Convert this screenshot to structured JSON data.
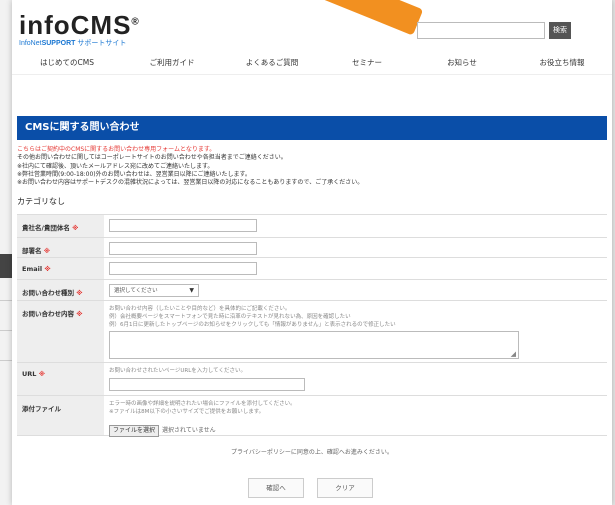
{
  "header": {
    "logo_text": "infoCMS",
    "logo_mark": "®",
    "logo_sub_brand": "InfoNet",
    "logo_sub_bold": "SUPPORT",
    "logo_sub_tail": "サポートサイト",
    "search_button": "検索",
    "search_placeholder": ""
  },
  "nav": [
    {
      "label": "はじめてのCMS"
    },
    {
      "label": "ご利用ガイド"
    },
    {
      "label": "よくあるご質問"
    },
    {
      "label": "セミナー"
    },
    {
      "label": "お知らせ"
    },
    {
      "label": "お役立ち情報"
    }
  ],
  "page_title": "CMSに関する問い合わせ",
  "intro": {
    "line1": "こちらはご契約中のCMSに関するお問い合わせ専用フォームとなります。",
    "line2": "その他お問い合わせに関してはコーポレートサイトのお問い合わせや各担当者までご連絡ください。",
    "line3": "※社内にて確認後、頂いたメールアドレス宛に改めてご連絡いたします。",
    "line4": "※弊社営業時間(9:00-18:00)外のお問い合わせは、翌営業日以降にご連絡いたします。",
    "line5": "※お問い合わせ内容はサポートデスクの混雑状況によっては、翌営業日以降の対応になることもありますので、ご了承ください。"
  },
  "category_label": "カテゴリなし",
  "form": {
    "company": {
      "label": "貴社名/貴団体名",
      "req": "※",
      "value": ""
    },
    "department": {
      "label": "部署名",
      "req": "※",
      "value": ""
    },
    "email": {
      "label": "Email",
      "req": "※",
      "value": ""
    },
    "inquiry_type": {
      "label": "お問い合わせ種別",
      "req": "※",
      "selected": "選択してください"
    },
    "inquiry_content": {
      "label": "お問い合わせ内容",
      "req": "※",
      "hint1": "お問い合わせ内容（したいことや目的など）を具体的にご記載ください。",
      "hint2": "例）会社概要ページをスマートフォンで見た時に沿革のテキストが見れない為、原因を確認したい",
      "hint3": "例）6月1日に更新したトップページのお知らせをクリックしても「情報がありません」と表示されるので修正したい",
      "value": ""
    },
    "url": {
      "label": "URL",
      "req": "※",
      "hint": "お問い合わせされたいページURLを入力してください。",
      "value": ""
    },
    "attachment": {
      "label": "添付ファイル",
      "hint1": "エラー時の画像や詳細を説明されたい場合にファイルを添付してください。",
      "hint2": "※ファイルは8M以下の小さいサイズでご提供をお願いします。",
      "button": "ファイルを選択",
      "status": "選択されていません"
    }
  },
  "privacy_text": "プライバシーポリシーに同意の上、確認へお進みください。",
  "buttons": {
    "confirm": "確認へ",
    "clear": "クリア"
  },
  "colors": {
    "title_bar": "#0a4ea8",
    "required": "#e53935",
    "accent": "#f29020",
    "link": "#1976d2"
  }
}
